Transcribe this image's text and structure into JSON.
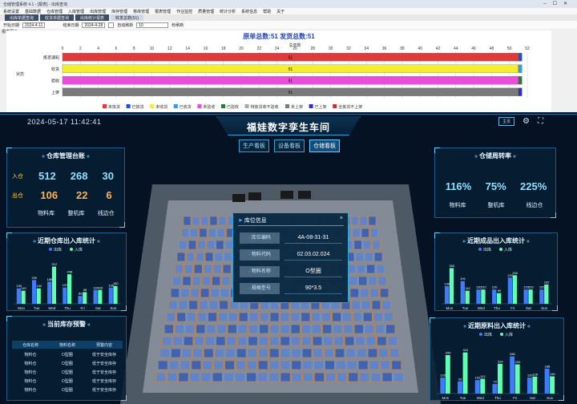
{
  "window": {
    "title": "仓储管理系统 4.1 - [报表] - 出库查询",
    "menu": [
      "系统设置",
      "基础数据",
      "仓库管理",
      "入库管理",
      "出库管理",
      "库存管理",
      "移库管理",
      "报表管理",
      "作业监控",
      "质量管理",
      "统计分析",
      "系统信息",
      "帮助",
      "关于"
    ],
    "tabs": [
      {
        "label": "出库单据查询",
        "active": false
      },
      {
        "label": "收货单据查询",
        "active": false
      },
      {
        "label": "出库统计报表",
        "active": false
      },
      {
        "label": "收发总数(51)",
        "active": true
      }
    ],
    "filters": {
      "start_label": "开始日期",
      "start_value": "2024-4-11",
      "end_label": "结束日期",
      "end_value": "2024-4-28",
      "refresh_label": "自动刷新",
      "refresh_value": "10",
      "refresh_unit": "秒刷新"
    },
    "report_label": "报表图示"
  },
  "report_chart": {
    "chart_data": {
      "type": "bar",
      "orientation": "horizontal",
      "stacked": true,
      "title": "原单总数:51  发货总数:51",
      "xlabel": "总单数",
      "ylabel": "状态",
      "xlim": [
        0,
        52
      ],
      "xticks": [
        0,
        2,
        4,
        6,
        8,
        10,
        12,
        14,
        16,
        18,
        20,
        22,
        24,
        26,
        28,
        30,
        32,
        34,
        36,
        38,
        40,
        42,
        44,
        46,
        48,
        50,
        52
      ],
      "categories": [
        "拣货通知",
        "收货",
        "验收",
        "上架"
      ],
      "series": [
        {
          "name": "未拣货",
          "color": "#e23a3a",
          "values": [
            51,
            0,
            0,
            0
          ]
        },
        {
          "name": "已拣货",
          "color": "#1f4fd8",
          "values": [
            0.4,
            0,
            0,
            0
          ]
        },
        {
          "name": "未收货",
          "color": "#f4ef2a",
          "values": [
            0,
            51,
            0,
            0
          ]
        },
        {
          "name": "已收货",
          "color": "#2aa0e8",
          "values": [
            0,
            0.4,
            0,
            0
          ]
        },
        {
          "name": "未验收",
          "color": "#e84fd8",
          "values": [
            0,
            0,
            51,
            0
          ]
        },
        {
          "name": "已验收",
          "color": "#2a7a3a",
          "values": [
            0,
            0,
            0.4,
            0
          ]
        },
        {
          "name": "特拣货收不验收",
          "color": "#a8a8a8",
          "values": [
            0,
            0,
            0,
            0
          ]
        },
        {
          "name": "未上架",
          "color": "#7a7a7a",
          "values": [
            0,
            0,
            0,
            51
          ]
        },
        {
          "name": "已上架",
          "color": "#3030c8",
          "values": [
            0,
            0,
            0,
            0.4
          ]
        },
        {
          "name": "全拣货不上架",
          "color": "#c83030",
          "values": [
            0,
            0,
            0,
            0
          ]
        }
      ],
      "data_labels": [
        "51",
        "51",
        "51",
        "51"
      ],
      "grid": true,
      "legend": "bottom"
    }
  },
  "dashboard": {
    "datetime": "2024-05-17 11:42:41",
    "title": "福娃数字孪生车间",
    "topright_btn": "主页",
    "nav": [
      {
        "label": "生产看板",
        "active": false
      },
      {
        "label": "设备看板",
        "active": false
      },
      {
        "label": "仓储看板",
        "active": true
      }
    ],
    "ledger": {
      "title": "仓库管理台账",
      "row1_label": "入仓",
      "row1": [
        "512",
        "268",
        "30"
      ],
      "row2_label": "出仓",
      "row2": [
        "106",
        "22",
        "6"
      ],
      "cols": [
        "物料库",
        "整机库",
        "线边仓"
      ]
    },
    "turnover": {
      "title": "仓储周转率",
      "values": [
        "116%",
        "75%",
        "225%"
      ],
      "cols": [
        "物料库",
        "整机库",
        "线边仓"
      ]
    },
    "popup": {
      "title": "库位信息",
      "rows": [
        {
          "k": "库位编码",
          "v": "4A-08-31-31"
        },
        {
          "k": "物料代码",
          "v": "02.03.02.024"
        },
        {
          "k": "物料名称",
          "v": "O型圈"
        },
        {
          "k": "规格型号",
          "v": "90*3.5"
        }
      ]
    },
    "stock_alert": {
      "title": "当前库存预警",
      "headers": [
        "仓库名称",
        "物料名称",
        "预警内容"
      ],
      "rows": [
        [
          "物料仓",
          "O型圈",
          "低于安全库存"
        ],
        [
          "物料仓",
          "O型圈",
          "低于安全库存"
        ],
        [
          "物料仓",
          "O型圈",
          "低于安全库存"
        ],
        [
          "物料仓",
          "O型圈",
          "低于安全库存"
        ],
        [
          "物料仓",
          "O型圈",
          "低于安全库存"
        ]
      ]
    },
    "colors": {
      "out": "#3d7cff",
      "in": "#5dffb0",
      "accent": "#2aa3d8"
    }
  },
  "chart_data": [
    {
      "type": "bar",
      "title": "近期仓库出入库统计",
      "categories": [
        "Mon",
        "Tue",
        "Wed",
        "Thu",
        "Fri",
        "Sat",
        "Sun"
      ],
      "series": [
        {
          "name": "出库",
          "values": [
            130,
            200,
            186,
            137,
            66,
            116,
            136
          ]
        },
        {
          "name": "入库",
          "values": [
            110,
            130,
            312,
            248,
            98,
            116,
            150
          ]
        }
      ],
      "ylim": [
        0,
        350
      ],
      "legend": "top"
    },
    {
      "type": "bar",
      "title": "近期成品出入库统计",
      "categories": [
        "Mon",
        "Tue",
        "Wed",
        "Thu",
        "Fri",
        "Sat",
        "Sun"
      ],
      "series": [
        {
          "name": "出库",
          "values": [
            149,
            191,
            120,
            120,
            220,
            120,
            120
          ]
        },
        {
          "name": "入库",
          "values": [
            300,
            110,
            120,
            90,
            240,
            120,
            162
          ]
        }
      ],
      "ylim": [
        0,
        350
      ],
      "legend": "top"
    },
    {
      "type": "bar",
      "title": "近期原料出入库统计",
      "categories": [
        "Mon",
        "Tue",
        "Wed",
        "Thu",
        "Fri",
        "Sat",
        "Sun"
      ],
      "series": [
        {
          "name": "出库",
          "values": [
            120,
            92,
            102,
            72,
            280,
            120,
            188
          ]
        },
        {
          "name": "入库",
          "values": [
            290,
            310,
            112,
            224,
            220,
            128,
            130
          ]
        }
      ],
      "ylim": [
        0,
        350
      ],
      "legend": "top"
    }
  ]
}
